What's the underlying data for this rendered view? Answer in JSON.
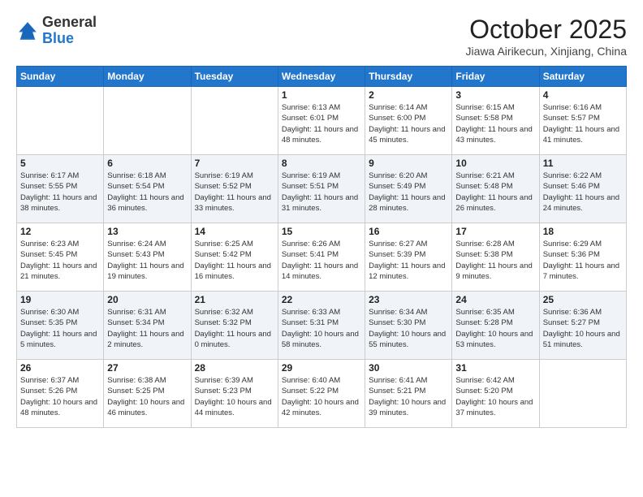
{
  "header": {
    "logo": {
      "general": "General",
      "blue": "Blue"
    },
    "title": "October 2025",
    "location": "Jiawa Airikecun, Xinjiang, China"
  },
  "weekdays": [
    "Sunday",
    "Monday",
    "Tuesday",
    "Wednesday",
    "Thursday",
    "Friday",
    "Saturday"
  ],
  "weeks": [
    [
      {
        "day": "",
        "info": ""
      },
      {
        "day": "",
        "info": ""
      },
      {
        "day": "",
        "info": ""
      },
      {
        "day": "1",
        "info": "Sunrise: 6:13 AM\nSunset: 6:01 PM\nDaylight: 11 hours and 48 minutes."
      },
      {
        "day": "2",
        "info": "Sunrise: 6:14 AM\nSunset: 6:00 PM\nDaylight: 11 hours and 45 minutes."
      },
      {
        "day": "3",
        "info": "Sunrise: 6:15 AM\nSunset: 5:58 PM\nDaylight: 11 hours and 43 minutes."
      },
      {
        "day": "4",
        "info": "Sunrise: 6:16 AM\nSunset: 5:57 PM\nDaylight: 11 hours and 41 minutes."
      }
    ],
    [
      {
        "day": "5",
        "info": "Sunrise: 6:17 AM\nSunset: 5:55 PM\nDaylight: 11 hours and 38 minutes."
      },
      {
        "day": "6",
        "info": "Sunrise: 6:18 AM\nSunset: 5:54 PM\nDaylight: 11 hours and 36 minutes."
      },
      {
        "day": "7",
        "info": "Sunrise: 6:19 AM\nSunset: 5:52 PM\nDaylight: 11 hours and 33 minutes."
      },
      {
        "day": "8",
        "info": "Sunrise: 6:19 AM\nSunset: 5:51 PM\nDaylight: 11 hours and 31 minutes."
      },
      {
        "day": "9",
        "info": "Sunrise: 6:20 AM\nSunset: 5:49 PM\nDaylight: 11 hours and 28 minutes."
      },
      {
        "day": "10",
        "info": "Sunrise: 6:21 AM\nSunset: 5:48 PM\nDaylight: 11 hours and 26 minutes."
      },
      {
        "day": "11",
        "info": "Sunrise: 6:22 AM\nSunset: 5:46 PM\nDaylight: 11 hours and 24 minutes."
      }
    ],
    [
      {
        "day": "12",
        "info": "Sunrise: 6:23 AM\nSunset: 5:45 PM\nDaylight: 11 hours and 21 minutes."
      },
      {
        "day": "13",
        "info": "Sunrise: 6:24 AM\nSunset: 5:43 PM\nDaylight: 11 hours and 19 minutes."
      },
      {
        "day": "14",
        "info": "Sunrise: 6:25 AM\nSunset: 5:42 PM\nDaylight: 11 hours and 16 minutes."
      },
      {
        "day": "15",
        "info": "Sunrise: 6:26 AM\nSunset: 5:41 PM\nDaylight: 11 hours and 14 minutes."
      },
      {
        "day": "16",
        "info": "Sunrise: 6:27 AM\nSunset: 5:39 PM\nDaylight: 11 hours and 12 minutes."
      },
      {
        "day": "17",
        "info": "Sunrise: 6:28 AM\nSunset: 5:38 PM\nDaylight: 11 hours and 9 minutes."
      },
      {
        "day": "18",
        "info": "Sunrise: 6:29 AM\nSunset: 5:36 PM\nDaylight: 11 hours and 7 minutes."
      }
    ],
    [
      {
        "day": "19",
        "info": "Sunrise: 6:30 AM\nSunset: 5:35 PM\nDaylight: 11 hours and 5 minutes."
      },
      {
        "day": "20",
        "info": "Sunrise: 6:31 AM\nSunset: 5:34 PM\nDaylight: 11 hours and 2 minutes."
      },
      {
        "day": "21",
        "info": "Sunrise: 6:32 AM\nSunset: 5:32 PM\nDaylight: 11 hours and 0 minutes."
      },
      {
        "day": "22",
        "info": "Sunrise: 6:33 AM\nSunset: 5:31 PM\nDaylight: 10 hours and 58 minutes."
      },
      {
        "day": "23",
        "info": "Sunrise: 6:34 AM\nSunset: 5:30 PM\nDaylight: 10 hours and 55 minutes."
      },
      {
        "day": "24",
        "info": "Sunrise: 6:35 AM\nSunset: 5:28 PM\nDaylight: 10 hours and 53 minutes."
      },
      {
        "day": "25",
        "info": "Sunrise: 6:36 AM\nSunset: 5:27 PM\nDaylight: 10 hours and 51 minutes."
      }
    ],
    [
      {
        "day": "26",
        "info": "Sunrise: 6:37 AM\nSunset: 5:26 PM\nDaylight: 10 hours and 48 minutes."
      },
      {
        "day": "27",
        "info": "Sunrise: 6:38 AM\nSunset: 5:25 PM\nDaylight: 10 hours and 46 minutes."
      },
      {
        "day": "28",
        "info": "Sunrise: 6:39 AM\nSunset: 5:23 PM\nDaylight: 10 hours and 44 minutes."
      },
      {
        "day": "29",
        "info": "Sunrise: 6:40 AM\nSunset: 5:22 PM\nDaylight: 10 hours and 42 minutes."
      },
      {
        "day": "30",
        "info": "Sunrise: 6:41 AM\nSunset: 5:21 PM\nDaylight: 10 hours and 39 minutes."
      },
      {
        "day": "31",
        "info": "Sunrise: 6:42 AM\nSunset: 5:20 PM\nDaylight: 10 hours and 37 minutes."
      },
      {
        "day": "",
        "info": ""
      }
    ]
  ],
  "colors": {
    "header_bg": "#2277cc",
    "row_shaded": "#f0f4f8",
    "row_white": "#ffffff"
  }
}
